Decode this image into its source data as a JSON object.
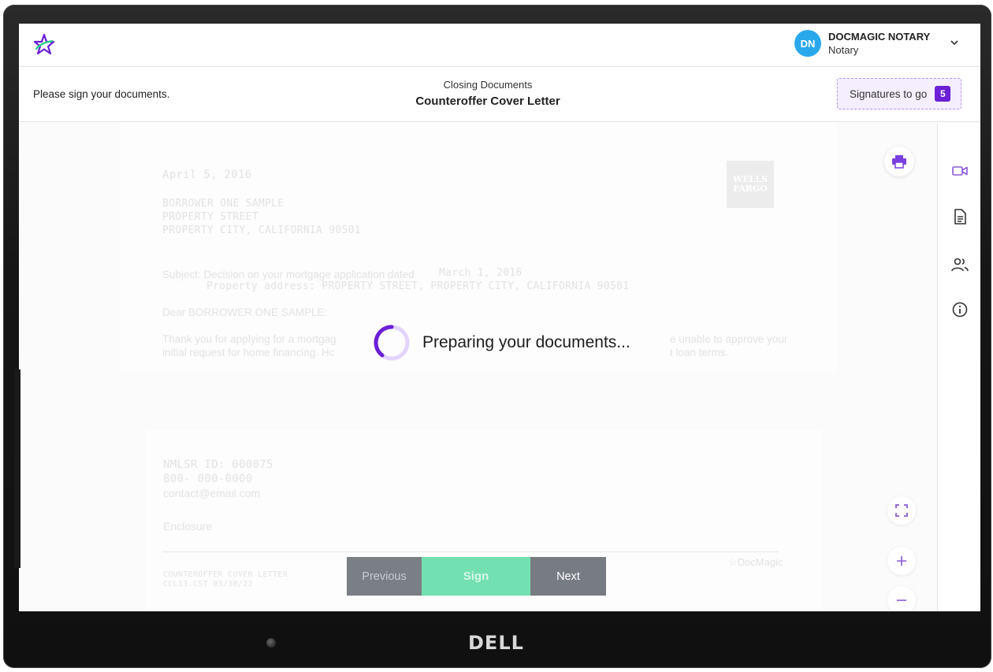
{
  "header": {
    "user_initials": "DN",
    "user_name": "DOCMAGIC NOTARY",
    "user_role": "Notary"
  },
  "subheader": {
    "instruction": "Please sign your documents.",
    "doc_category": "Closing Documents",
    "doc_title": "Counteroffer Cover Letter",
    "signatures_label": "Signatures to go",
    "signatures_count": "5"
  },
  "document": {
    "date": "April 5, 2016",
    "address_lines": [
      "BORROWER ONE SAMPLE",
      "PROPERTY STREET",
      "PROPERTY CITY, CALIFORNIA 90501"
    ],
    "subject_label": "Subject: Decision on your mortgage application dated",
    "subject_date": "March 1, 2016",
    "property_line": "Property address: PROPERTY STREET, PROPERTY CITY, CALIFORNIA 90501",
    "greeting": "Dear BORROWER ONE SAMPLE:",
    "body_line1_left": "Thank you for applying for a mortgag",
    "body_line1_right": "e unable to approve your",
    "body_line2_left": "initial request for home financing. Hc",
    "body_line2_right": "t loan terms.",
    "logo_line1": "WELLS",
    "logo_line2": "FARGO",
    "nmlsr": "NMLSR ID: 000075",
    "phone": "800- 000-0000",
    "email": "contact@email.com",
    "enclosure": "Enclosure",
    "footer_title": "COUNTEROFFER COVER LETTER",
    "footer_code": "CCL13.CST  03/30/22",
    "footer_brand": "☆DocMagic"
  },
  "loading": {
    "text": "Preparing your documents..."
  },
  "nav": {
    "previous": "Previous",
    "sign": "Sign",
    "next": "Next"
  },
  "device": {
    "brand": "DELL"
  },
  "colors": {
    "accent": "#6b1fd6",
    "avatar": "#2aa8ec",
    "sign_button": "#72e0b0",
    "nav_button": "#777c82"
  },
  "icons": [
    "star-logo-icon",
    "chevron-down-icon",
    "print-icon",
    "video-icon",
    "document-icon",
    "participants-icon",
    "info-icon",
    "fullscreen-icon",
    "zoom-in-icon",
    "zoom-out-icon"
  ]
}
